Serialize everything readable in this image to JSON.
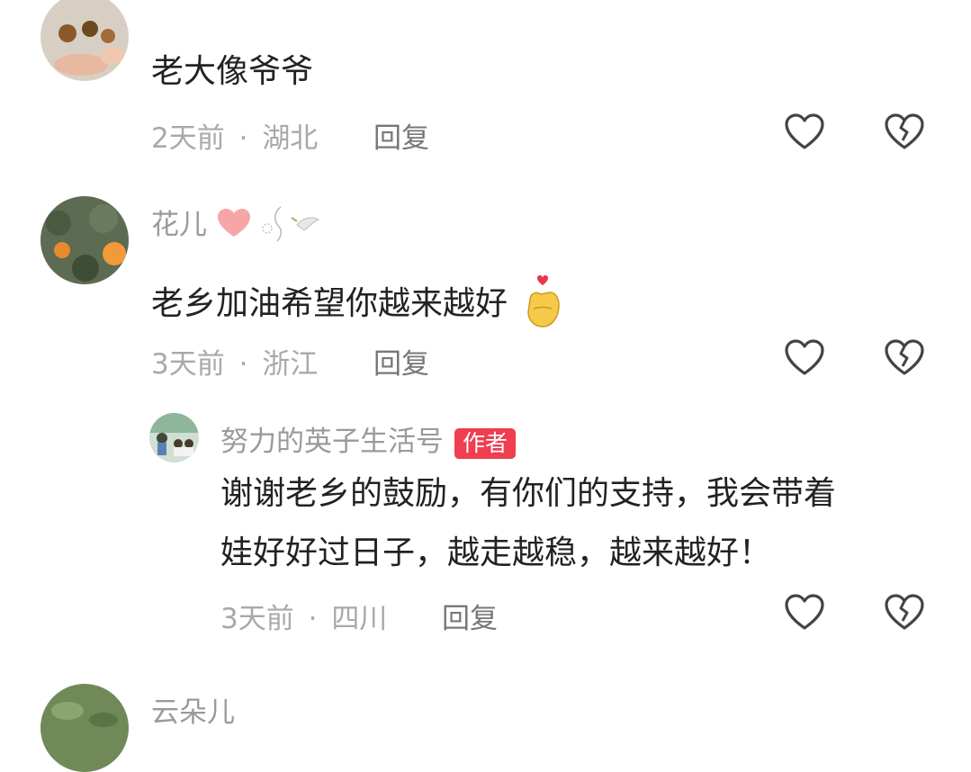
{
  "comments": [
    {
      "text": "老大像爷爷",
      "time": "2天前",
      "dot": "·",
      "location": "湖北",
      "reply_label": "回复"
    },
    {
      "username": "花儿",
      "text": "老乡加油希望你越来越好",
      "time": "3天前",
      "dot": "·",
      "location": "浙江",
      "reply_label": "回复",
      "emoji": "heart-hand"
    },
    {
      "username": "努力的英子生活号",
      "badge": "作者",
      "text_line1": "谢谢老乡的鼓励，有你们的支持，我会带着",
      "text_line2": "娃好好过日子，越走越稳，越来越好！",
      "time": "3天前",
      "dot": "·",
      "location": "四川",
      "reply_label": "回复"
    },
    {
      "username": "云朵儿"
    }
  ],
  "colors": {
    "badge": "#ee3e4f",
    "text": "#222222",
    "meta": "#a9a9a9"
  }
}
